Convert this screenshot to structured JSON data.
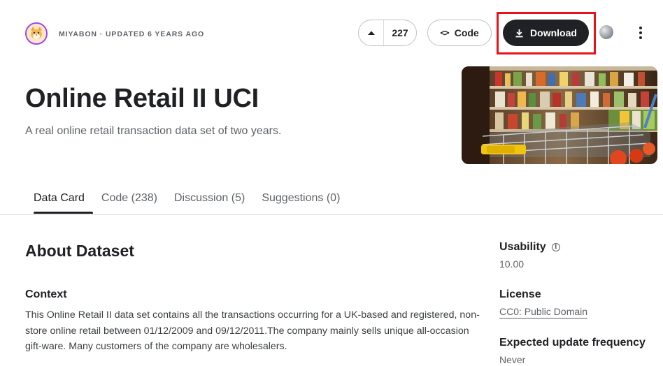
{
  "header": {
    "owner_line": "MIYABON · UPDATED 6 YEARS AGO",
    "upvote_count": "227",
    "code_label": "Code",
    "download_label": "Download"
  },
  "dataset": {
    "title": "Online Retail II UCI",
    "subtitle": "A real online retail transaction data set of two years."
  },
  "tabs": [
    {
      "label": "Data Card",
      "active": true
    },
    {
      "label": "Code (238)",
      "active": false
    },
    {
      "label": "Discussion (5)",
      "active": false
    },
    {
      "label": "Suggestions (0)",
      "active": false
    }
  ],
  "main": {
    "section_title": "About Dataset",
    "context_heading": "Context",
    "context_text": "This Online Retail II data set contains all the transactions occurring for a UK-based and registered, non-store online retail between 01/12/2009 and 09/12/2011.The company mainly sells unique all-occasion gift-ware. Many customers of the company are wholesalers."
  },
  "sidebar": {
    "usability_label": "Usability",
    "usability_value": "10.00",
    "license_label": "License",
    "license_value": "CC0: Public Domain",
    "frequency_label": "Expected update frequency",
    "frequency_value": "Never"
  },
  "colors": {
    "download_bg": "#202124",
    "highlight_border": "#e8121b",
    "avatar_ring": "#a142f4"
  }
}
